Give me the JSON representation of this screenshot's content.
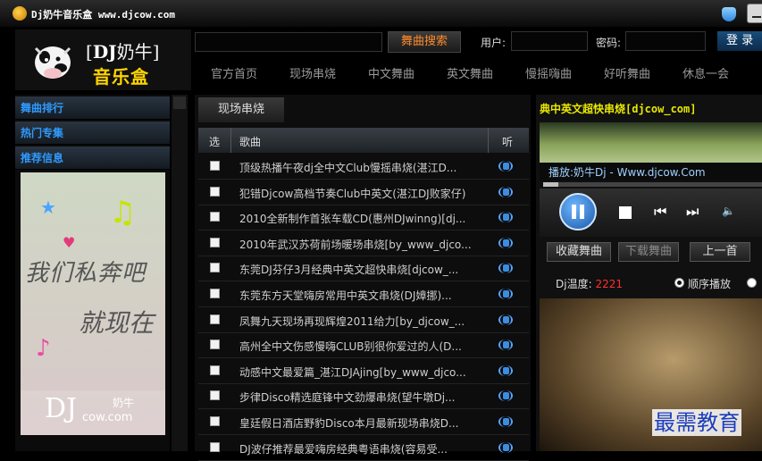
{
  "window": {
    "title": "Dj奶牛音乐盒 www.djcow.com"
  },
  "logo": {
    "brand": "DJ",
    "brand_suffix": "奶牛",
    "subtitle": "音乐盒"
  },
  "search": {
    "button_label": "舞曲搜索",
    "user_label": "用户:",
    "password_label": "密码:",
    "login_label": "登 录"
  },
  "nav": [
    "官方首页",
    "现场串烧",
    "中文舞曲",
    "英文舞曲",
    "慢摇嗨曲",
    "好听舞曲",
    "休息一会"
  ],
  "sidebar": {
    "sections": [
      "舞曲排行",
      "热门专集",
      "推荐信息"
    ],
    "promo": {
      "text_line1": "我们私奔吧",
      "text_line2": "就现在",
      "logo_dj": "DJ",
      "logo_cow": "cow.com",
      "logo_nn": "奶牛"
    }
  },
  "list": {
    "tab_label": "现场串烧",
    "headers": {
      "select": "选",
      "song": "歌曲",
      "listen": "听"
    },
    "rows": [
      "顶级热播午夜dj全中文Club慢摇串烧(湛江D...",
      "犯错Djcow高档节奏Club中英文(湛江DJ败家仔)",
      "2010全新制作首张车载CD(惠州DJwinng)[dj...",
      "2010年武汉苏荷前场暖场串烧[by_www_djco...",
      "东莞DJ芬仔3月经典中英文超快串烧[djcow_...",
      "东莞东方天堂嗨房常用中英文串烧(DJ嫜挪)...",
      "凤舞九天现场再现辉煌2011给力[by_djcow_...",
      "高州全中文伤感慢嗨CLUB别很你爱过的人(D...",
      "动感中文最爱篇_湛江DJAjing[by_www_djco...",
      "步律Disco精选庭锋中文劲爆串烧(望牛墩Dj...",
      "皇廷假日酒店野豹Disco本月最新现场串烧D...",
      "DJ波仔推荐最爱嗨房经典粤语串烧(容易受..."
    ]
  },
  "player": {
    "title": "典中英文超快串烧[djcow_com]",
    "now_playing": "播放:奶牛Dj - Www.djcow.Com",
    "progress": 0.07,
    "buttons": {
      "collect": "收藏舞曲",
      "download": "下载舞曲",
      "previous": "上一首"
    },
    "heat_label": "Dj温度:",
    "heat_value": "2221",
    "order_label": "顺序播放"
  },
  "watermark": "最需教育"
}
